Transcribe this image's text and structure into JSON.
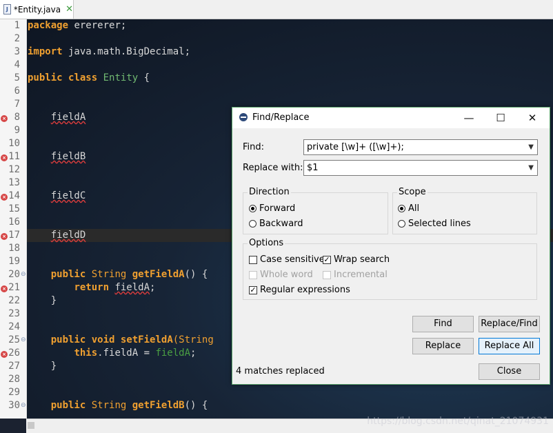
{
  "tab": {
    "label": "*Entity.java",
    "close": "✕"
  },
  "lines": [
    {
      "n": "1",
      "parts": [
        {
          "t": "package",
          "c": "kw"
        },
        {
          "t": " erererer;",
          "c": ""
        }
      ]
    },
    {
      "n": "2",
      "parts": []
    },
    {
      "n": "3",
      "parts": [
        {
          "t": "import",
          "c": "kw"
        },
        {
          "t": " java.math.BigDecimal;",
          "c": ""
        }
      ]
    },
    {
      "n": "4",
      "parts": []
    },
    {
      "n": "5",
      "parts": [
        {
          "t": "public",
          "c": "kw"
        },
        {
          "t": " ",
          "c": ""
        },
        {
          "t": "class",
          "c": "kw"
        },
        {
          "t": " ",
          "c": ""
        },
        {
          "t": "Entity",
          "c": "cls"
        },
        {
          "t": " {",
          "c": ""
        }
      ]
    },
    {
      "n": "6",
      "parts": []
    },
    {
      "n": "7",
      "parts": []
    },
    {
      "n": "8",
      "parts": [
        {
          "t": "    ",
          "c": ""
        },
        {
          "t": "fieldA",
          "c": "err"
        }
      ],
      "mark": true
    },
    {
      "n": "9",
      "parts": []
    },
    {
      "n": "10",
      "parts": []
    },
    {
      "n": "11",
      "parts": [
        {
          "t": "    ",
          "c": ""
        },
        {
          "t": "fieldB",
          "c": "err"
        }
      ],
      "mark": true
    },
    {
      "n": "12",
      "parts": []
    },
    {
      "n": "13",
      "parts": []
    },
    {
      "n": "14",
      "parts": [
        {
          "t": "    ",
          "c": ""
        },
        {
          "t": "fieldC",
          "c": "err"
        }
      ],
      "mark": true
    },
    {
      "n": "15",
      "parts": []
    },
    {
      "n": "16",
      "parts": []
    },
    {
      "n": "17",
      "parts": [
        {
          "t": "    ",
          "c": ""
        },
        {
          "t": "fieldD",
          "c": "err"
        }
      ],
      "mark": true
    },
    {
      "n": "18",
      "parts": []
    },
    {
      "n": "19",
      "parts": []
    },
    {
      "n": "20",
      "parts": [
        {
          "t": "    ",
          "c": ""
        },
        {
          "t": "public",
          "c": "kw"
        },
        {
          "t": " ",
          "c": ""
        },
        {
          "t": "String",
          "c": "ty"
        },
        {
          "t": " ",
          "c": ""
        },
        {
          "t": "getFieldA",
          "c": "meth"
        },
        {
          "t": "() {",
          "c": ""
        }
      ],
      "fold": true
    },
    {
      "n": "21",
      "parts": [
        {
          "t": "        ",
          "c": ""
        },
        {
          "t": "return",
          "c": "kw"
        },
        {
          "t": " ",
          "c": ""
        },
        {
          "t": "fieldA",
          "c": "err"
        },
        {
          "t": ";",
          "c": ""
        }
      ],
      "mark": true
    },
    {
      "n": "22",
      "parts": [
        {
          "t": "    }",
          "c": ""
        }
      ]
    },
    {
      "n": "23",
      "parts": []
    },
    {
      "n": "24",
      "parts": []
    },
    {
      "n": "25",
      "parts": [
        {
          "t": "    ",
          "c": ""
        },
        {
          "t": "public",
          "c": "kw"
        },
        {
          "t": " ",
          "c": ""
        },
        {
          "t": "void",
          "c": "kw"
        },
        {
          "t": " ",
          "c": ""
        },
        {
          "t": "setFieldA",
          "c": "meth"
        },
        {
          "t": "(String",
          "c": "ty"
        }
      ],
      "fold": true
    },
    {
      "n": "26",
      "parts": [
        {
          "t": "        ",
          "c": ""
        },
        {
          "t": "this",
          "c": "kw"
        },
        {
          "t": ".fieldA = ",
          "c": ""
        },
        {
          "t": "fieldA",
          "c": "grn"
        },
        {
          "t": ";",
          "c": ""
        }
      ],
      "mark": true
    },
    {
      "n": "27",
      "parts": [
        {
          "t": "    }",
          "c": ""
        }
      ]
    },
    {
      "n": "28",
      "parts": []
    },
    {
      "n": "29",
      "parts": []
    },
    {
      "n": "30",
      "parts": [
        {
          "t": "    ",
          "c": ""
        },
        {
          "t": "public",
          "c": "kw"
        },
        {
          "t": " ",
          "c": ""
        },
        {
          "t": "String",
          "c": "ty"
        },
        {
          "t": " ",
          "c": ""
        },
        {
          "t": "getFieldB",
          "c": "meth"
        },
        {
          "t": "() {",
          "c": ""
        }
      ],
      "fold": true
    }
  ],
  "watermark": "https://blog.csdn.net/qinat_21074931",
  "dialog": {
    "title": "Find/Replace",
    "minimize": "—",
    "maximize": "☐",
    "close": "✕",
    "find_label": "Find:",
    "find_value": "private [\\w]+ ([\\w]+);",
    "replace_label": "Replace with:",
    "replace_value": "$1",
    "direction": {
      "title": "Direction",
      "forward": "Forward",
      "backward": "Backward"
    },
    "scope": {
      "title": "Scope",
      "all": "All",
      "selected": "Selected lines"
    },
    "options": {
      "title": "Options",
      "case_sensitive": "Case sensitive",
      "wrap_search": "Wrap search",
      "whole_word": "Whole word",
      "incremental": "Incremental",
      "regex": "Regular expressions"
    },
    "buttons": {
      "find": "Find",
      "replace_find": "Replace/Find",
      "replace": "Replace",
      "replace_all": "Replace All",
      "close": "Close"
    },
    "status": "4 matches replaced"
  }
}
